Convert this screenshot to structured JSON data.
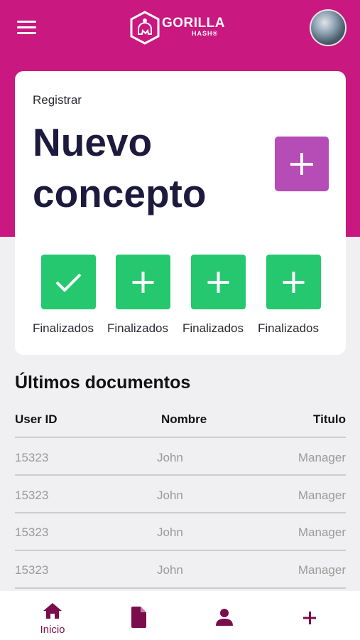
{
  "header": {
    "logo_text": "GORILLA",
    "logo_sub": "HASH®"
  },
  "card": {
    "eyebrow": "Registrar",
    "title": "Nuevo concepto",
    "steps": [
      {
        "label": "Finalizados",
        "icon": "check-icon"
      },
      {
        "label": "Finalizados",
        "icon": "plus-icon"
      },
      {
        "label": "Finalizados",
        "icon": "plus-icon"
      },
      {
        "label": "Finalizados",
        "icon": "plus-icon"
      }
    ]
  },
  "documents": {
    "title": "Últimos documentos",
    "columns": [
      "User ID",
      "Nombre",
      "Titulo"
    ],
    "rows": [
      [
        "15323",
        "John",
        "Manager"
      ],
      [
        "15323",
        "John",
        "Manager"
      ],
      [
        "15323",
        "John",
        "Manager"
      ],
      [
        "15323",
        "John",
        "Manager"
      ]
    ]
  },
  "nav": {
    "items": [
      {
        "label": "Inicio",
        "icon": "home-icon"
      },
      {
        "label": "",
        "icon": "document-icon"
      },
      {
        "label": "",
        "icon": "user-icon"
      },
      {
        "label": "",
        "icon": "plus-icon"
      }
    ]
  },
  "colors": {
    "brand": "#c9187f",
    "accent_purple": "#b64cb5",
    "success_green": "#25c86f",
    "nav_icon": "#7a0e4c",
    "title_dark": "#1d1a3e"
  }
}
